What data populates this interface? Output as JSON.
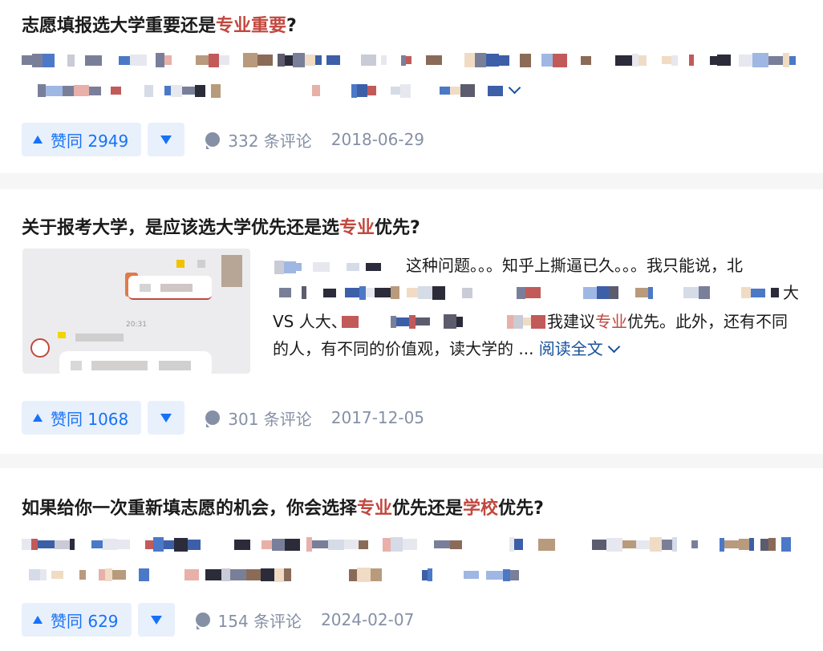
{
  "items": [
    {
      "title_parts": [
        "志愿填报选大学重要还是",
        "专业重要",
        "?"
      ],
      "read_more": "",
      "vote_label": "赞同 2949",
      "comments": "332 条评论",
      "date": "2018-06-29"
    },
    {
      "title_parts": [
        "关于报考大学，是应该选大学优先还是选",
        "专业",
        "优先?"
      ],
      "excerpt_line1": "这种问题。。。知乎上撕逼已久。。。我只能说，北",
      "excerpt_line2_tail": "大",
      "excerpt_line3_head": "VS 人大、",
      "excerpt_line3_mid": "我建议",
      "excerpt_line3_hl": "专业",
      "excerpt_line3_tail": "优先。此外，还有不同",
      "excerpt_line4": "的人，有不同的价值观，读大学的 ...",
      "read_more": "阅读全文",
      "thumb_time": "20:31",
      "vote_label": "赞同 1068",
      "comments": "301 条评论",
      "date": "2017-12-05"
    },
    {
      "title_parts": [
        "如果给你一次重新填志愿的机会，你会选择",
        "专业",
        "优先还是",
        "学校",
        "优先?"
      ],
      "vote_label": "赞同 629",
      "comments": "154 条评论",
      "date": "2024-02-07"
    }
  ],
  "colors": {
    "accent": "#1772f6",
    "highlight": "#c2483f",
    "link": "#175199",
    "meta": "#8590a6"
  },
  "icons": [
    "upvote-triangle-icon",
    "downvote-triangle-icon",
    "comment-bubble-icon",
    "chevron-down-icon"
  ]
}
